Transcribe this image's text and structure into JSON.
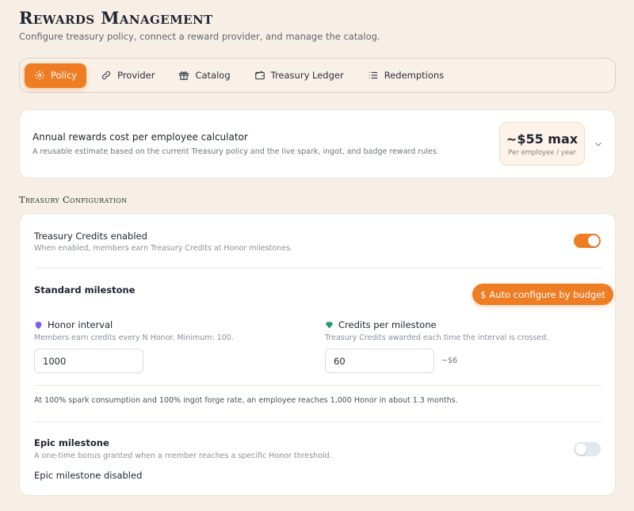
{
  "header": {
    "title": "Rewards Management",
    "subtitle": "Configure treasury policy, connect a reward provider, and manage the catalog."
  },
  "tabs": [
    {
      "label": "Policy",
      "icon": "gear-icon",
      "active": true
    },
    {
      "label": "Provider",
      "icon": "link-icon",
      "active": false
    },
    {
      "label": "Catalog",
      "icon": "gift-icon",
      "active": false
    },
    {
      "label": "Treasury Ledger",
      "icon": "wallet-icon",
      "active": false
    },
    {
      "label": "Redemptions",
      "icon": "list-icon",
      "active": false
    }
  ],
  "calculator": {
    "title": "Annual rewards cost per employee calculator",
    "description": "A reusable estimate based on the current Treasury policy and the live spark, ingot, and badge reward rules.",
    "cost_value": "~$55 max",
    "cost_label": "Per employee / year"
  },
  "treasury": {
    "section_title": "Treasury Configuration",
    "credits_enabled_label": "Treasury Credits enabled",
    "credits_enabled_hint": "When enabled, members earn Treasury Credits at Honor milestones.",
    "credits_enabled": true,
    "standard_milestone": {
      "title": "Standard milestone",
      "auto_button": "Auto configure by budget",
      "honor_interval_label": "Honor interval",
      "honor_interval_hint": "Members earn credits every N Honor. Minimum: 100.",
      "honor_interval_value": "1000",
      "credits_label": "Credits per milestone",
      "credits_hint": "Treasury Credits awarded each time the interval is crossed.",
      "credits_value": "60",
      "credits_approx": "~$6"
    },
    "note": "At 100% spark consumption and 100% ingot forge rate, an employee reaches 1,000 Honor in about 1.3 months.",
    "epic_milestone": {
      "title": "Epic milestone",
      "hint": "A one-time bonus granted when a member reaches a specific Honor threshold.",
      "enabled": false,
      "status": "Epic milestone disabled"
    }
  },
  "colors": {
    "accent": "#ef7d24",
    "background": "#f7efe5",
    "honor_icon": "#7c5cf0",
    "credits_icon": "#1f9d6b"
  }
}
